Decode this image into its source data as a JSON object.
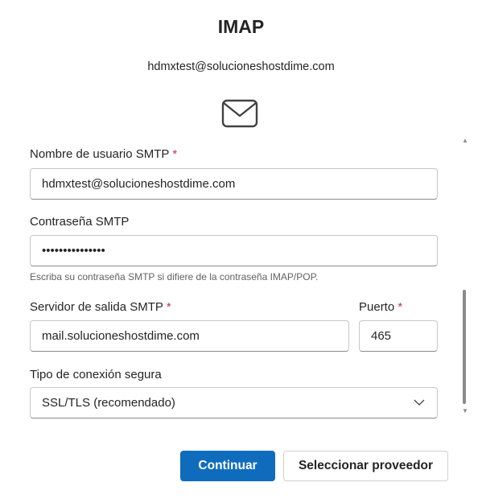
{
  "header": {
    "title": "IMAP",
    "account_email": "hdmxtest@solucioneshostdime.com",
    "icon": "mail-icon"
  },
  "form": {
    "smtp_username": {
      "label": "Nombre de usuario SMTP",
      "required_mark": "*",
      "value": "hdmxtest@solucioneshostdime.com"
    },
    "smtp_password": {
      "label": "Contraseña SMTP",
      "value": "•••••••••••••••",
      "hint": "Escriba su contraseña SMTP si difiere de la contraseña IMAP/POP."
    },
    "smtp_server": {
      "label": "Servidor de salida SMTP",
      "required_mark": "*",
      "value": "mail.solucioneshostdime.com"
    },
    "port": {
      "label": "Puerto",
      "required_mark": "*",
      "value": "465"
    },
    "connection_type": {
      "label": "Tipo de conexión segura",
      "selected": "SSL/TLS (recomendado)"
    }
  },
  "buttons": {
    "continue": "Continuar",
    "select_provider": "Seleccionar proveedor"
  },
  "colors": {
    "primary": "#0f6cbd",
    "required": "#c4314b"
  }
}
